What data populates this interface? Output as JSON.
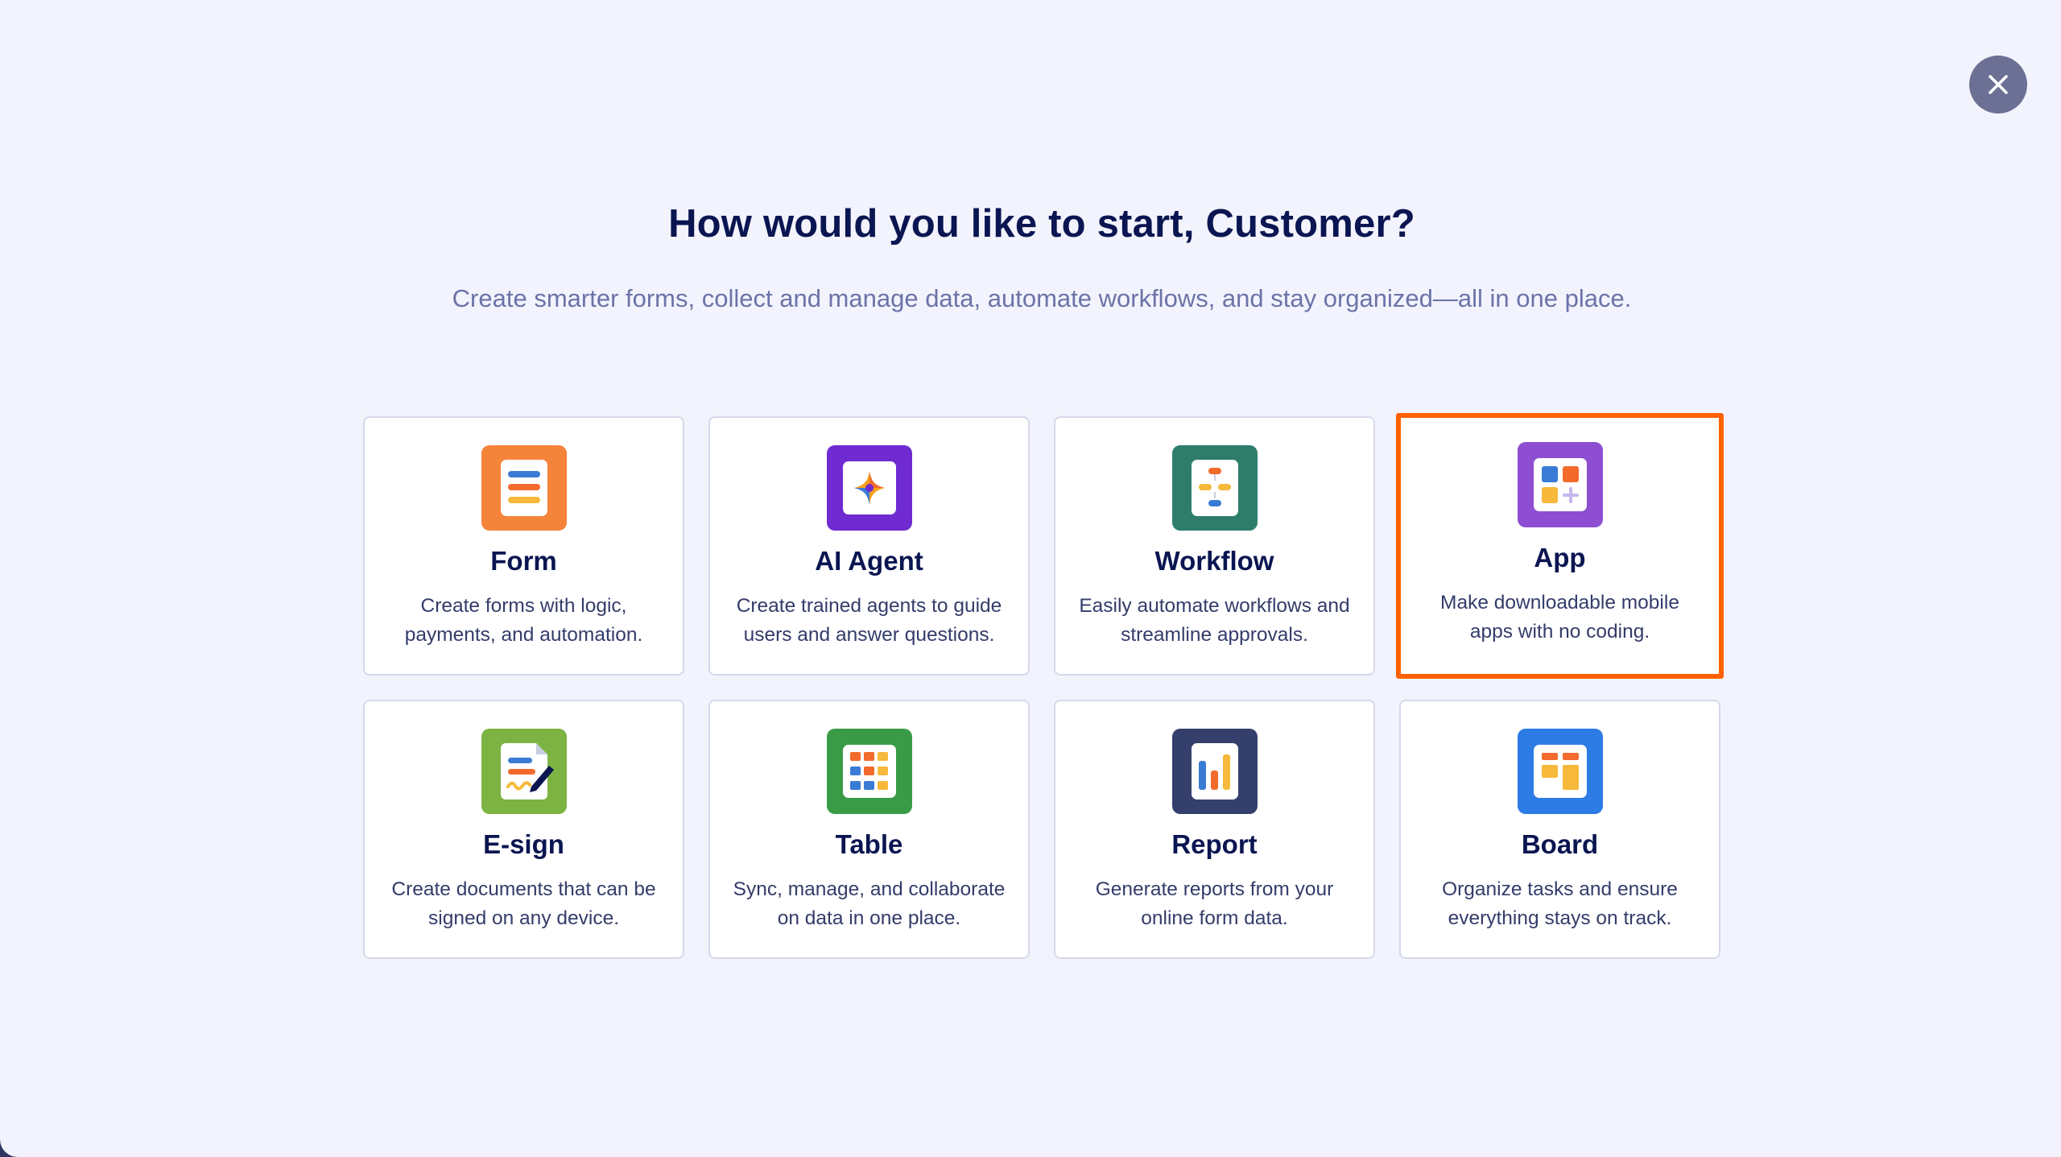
{
  "modal": {
    "title": "How would you like to start, Customer?",
    "subtitle": "Create smarter forms, collect and manage data, automate workflows, and stay organized—all in one place.",
    "close_icon": "close-icon"
  },
  "colors": {
    "background": "#f2f3fc",
    "title": "#0a1551",
    "selected_border": "#ff6100",
    "close_button": "#6c7094"
  },
  "cards": [
    {
      "title": "Form",
      "desc_line1": "Create forms with logic,",
      "desc_line2": "payments, and automation.",
      "icon": "form-icon",
      "color": "#f5843b"
    },
    {
      "title": "AI Agent",
      "desc_line1": "Create trained agents to guide",
      "desc_line2": "users and answer questions.",
      "icon": "ai-agent-icon",
      "color": "#6f2ad1"
    },
    {
      "title": "Workflow",
      "desc_line1": "Easily automate workflows and",
      "desc_line2": "streamline approvals.",
      "icon": "workflow-icon",
      "color": "#2e7d6b"
    },
    {
      "title": "App",
      "desc_line1": "Make downloadable mobile",
      "desc_line2": "apps with no coding.",
      "icon": "app-icon",
      "color": "#8e4ed1",
      "selected": true
    },
    {
      "title": "E-sign",
      "desc_line1": "Create documents that can be",
      "desc_line2": "signed on any device.",
      "icon": "esign-icon",
      "color": "#7cb342"
    },
    {
      "title": "Table",
      "desc_line1": "Sync, manage, and collaborate",
      "desc_line2": "on data in one place.",
      "icon": "table-icon",
      "color": "#3a9b47"
    },
    {
      "title": "Report",
      "desc_line1": "Generate reports from your",
      "desc_line2": "online form data.",
      "icon": "report-icon",
      "color": "#34406b"
    },
    {
      "title": "Board",
      "desc_line1": "Organize tasks and ensure",
      "desc_line2": "everything stays on track.",
      "icon": "board-icon",
      "color": "#2d7be5"
    }
  ]
}
